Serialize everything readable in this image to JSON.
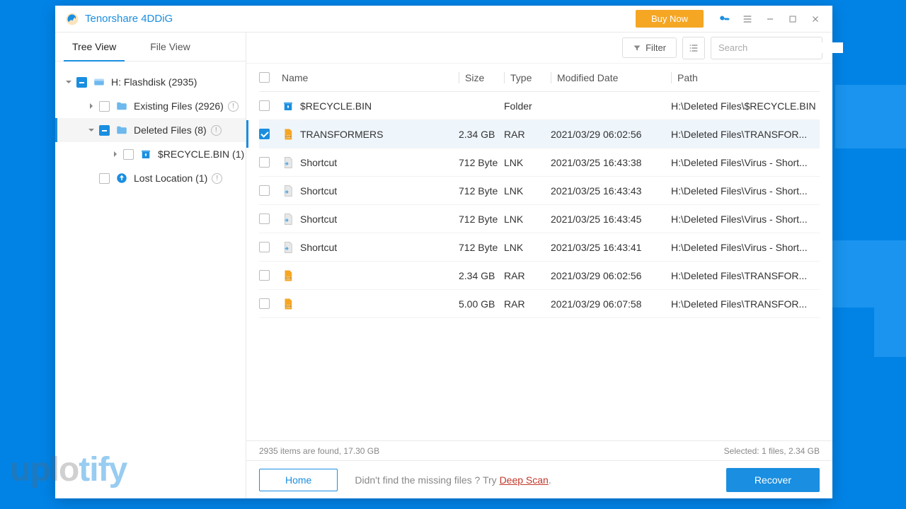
{
  "app": {
    "title": "Tenorshare 4DDiG",
    "buy_now": "Buy Now"
  },
  "tabs": {
    "tree_view": "Tree View",
    "file_view": "File View"
  },
  "tree": {
    "root": "H: Flashdisk (2935)",
    "existing": "Existing Files (2926)",
    "deleted": "Deleted Files (8)",
    "recycle": "$RECYCLE.BIN (1)",
    "lost": "Lost Location (1)"
  },
  "toolbar": {
    "filter": "Filter",
    "search_placeholder": "Search"
  },
  "columns": {
    "name": "Name",
    "size": "Size",
    "type": "Type",
    "date": "Modified Date",
    "path": "Path"
  },
  "rows": [
    {
      "name": "$RECYCLE.BIN",
      "size": "",
      "type": "Folder",
      "date": "",
      "path": "H:\\Deleted Files\\$RECYCLE.BIN",
      "icon": "folder-recycle",
      "checked": false
    },
    {
      "name": "TRANSFORMERS",
      "size": "2.34 GB",
      "type": "RAR",
      "date": "2021/03/29 06:02:56",
      "path": "H:\\Deleted Files\\TRANSFOR...",
      "icon": "rar",
      "checked": true
    },
    {
      "name": "Shortcut",
      "size": "712 Byte",
      "type": "LNK",
      "date": "2021/03/25 16:43:38",
      "path": "H:\\Deleted Files\\Virus - Short...",
      "icon": "lnk",
      "checked": false
    },
    {
      "name": "Shortcut",
      "size": "712 Byte",
      "type": "LNK",
      "date": "2021/03/25 16:43:43",
      "path": "H:\\Deleted Files\\Virus - Short...",
      "icon": "lnk",
      "checked": false
    },
    {
      "name": "Shortcut",
      "size": "712 Byte",
      "type": "LNK",
      "date": "2021/03/25 16:43:45",
      "path": "H:\\Deleted Files\\Virus - Short...",
      "icon": "lnk",
      "checked": false
    },
    {
      "name": "Shortcut",
      "size": "712 Byte",
      "type": "LNK",
      "date": "2021/03/25 16:43:41",
      "path": "H:\\Deleted Files\\Virus - Short...",
      "icon": "lnk",
      "checked": false
    },
    {
      "name": "",
      "size": "2.34 GB",
      "type": "RAR",
      "date": "2021/03/29 06:02:56",
      "path": "H:\\Deleted Files\\TRANSFOR...",
      "icon": "rar",
      "checked": false
    },
    {
      "name": "",
      "size": "5.00 GB",
      "type": "RAR",
      "date": "2021/03/29 06:07:58",
      "path": "H:\\Deleted Files\\TRANSFOR...",
      "icon": "rar",
      "checked": false
    }
  ],
  "status": {
    "found": "2935 items are found, 17.30 GB",
    "selected": "Selected: 1 files, 2.34 GB"
  },
  "footer": {
    "home": "Home",
    "hint_prefix": "Didn't find the missing files ? Try ",
    "hint_link": "Deep Scan",
    "recover": "Recover"
  },
  "watermark": {
    "a": "uplo",
    "b": "tify"
  }
}
